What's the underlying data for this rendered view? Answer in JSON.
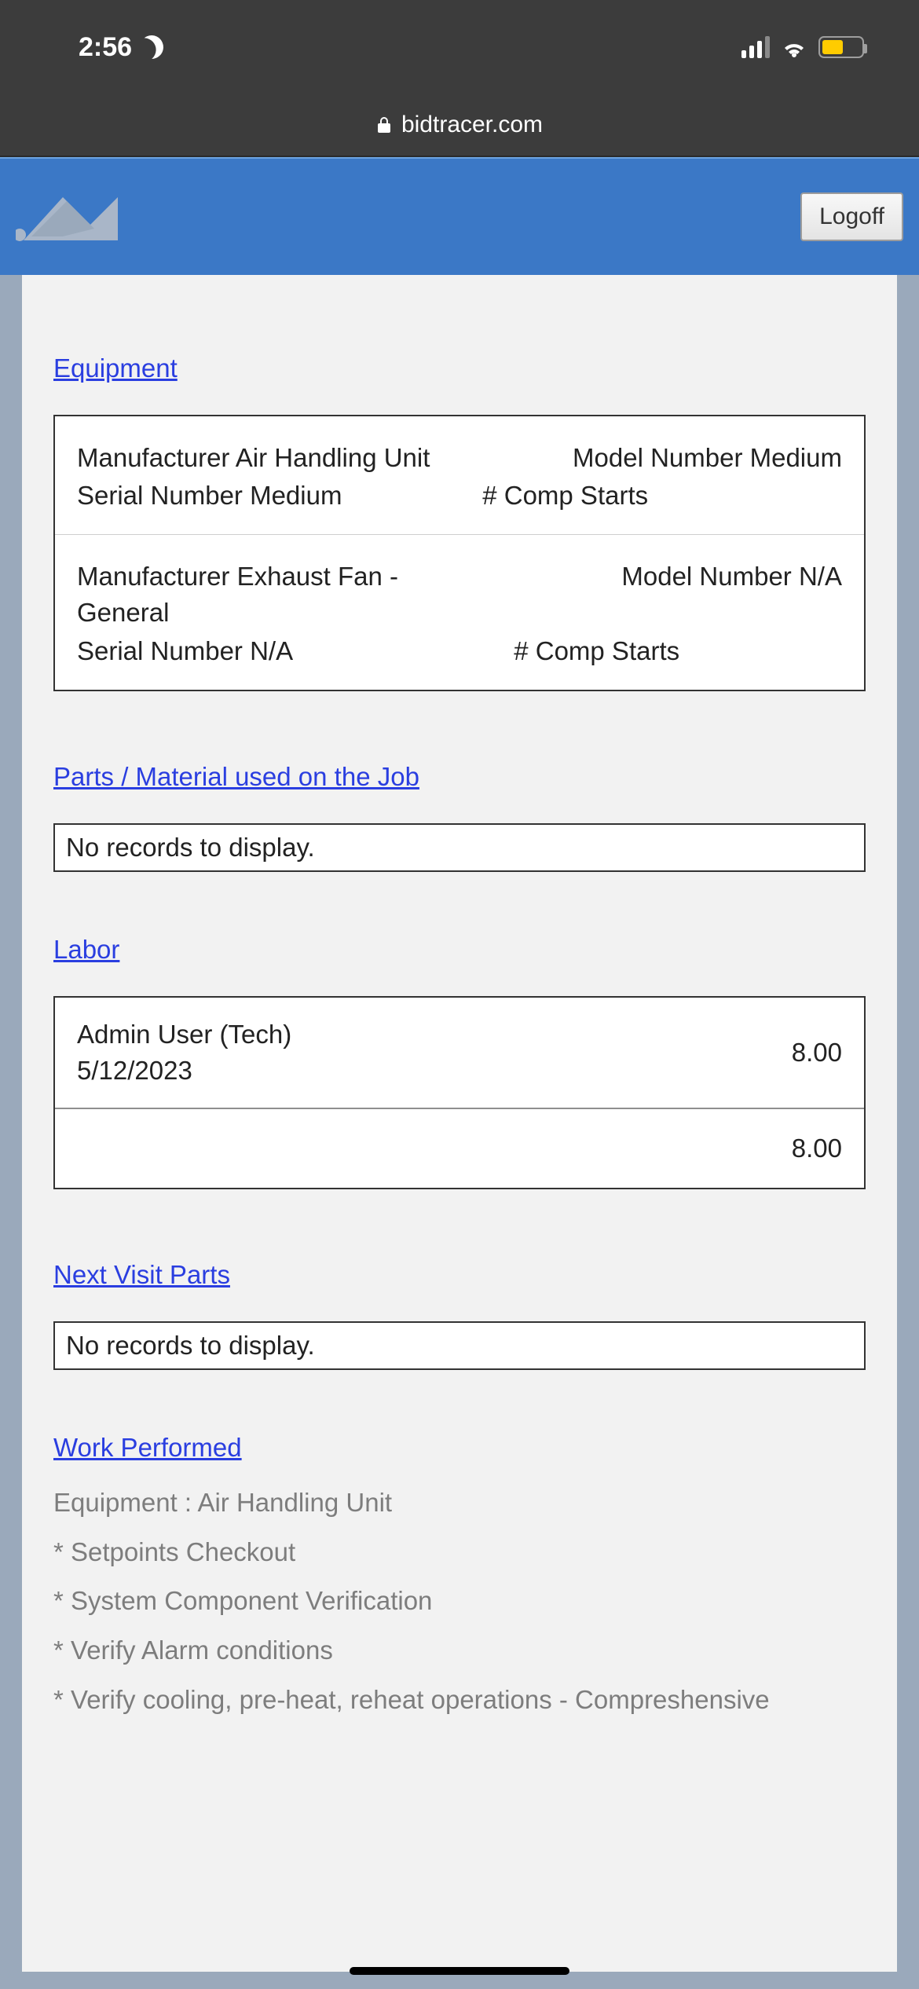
{
  "status": {
    "time": "2:56"
  },
  "browser": {
    "domain": "bidtracer.com"
  },
  "header": {
    "logoff_label": "Logoff"
  },
  "sections": {
    "equipment_label": "Equipment",
    "parts_label": "Parts / Material used on the Job",
    "labor_label": "Labor",
    "next_visit_label": "Next Visit Parts",
    "work_performed_label": "Work Performed"
  },
  "equipment": {
    "labels": {
      "manufacturer_prefix": "Manufacturer ",
      "model_prefix": "Model Number ",
      "serial_prefix": "Serial Number ",
      "comp_starts_prefix": "# Comp Starts "
    },
    "items": [
      {
        "manufacturer": "Air Handling Unit",
        "model": "Medium",
        "serial": "Medium",
        "comp_starts": ""
      },
      {
        "manufacturer": "Exhaust Fan - General",
        "model": "N/A",
        "serial": "N/A",
        "comp_starts": ""
      }
    ]
  },
  "parts": {
    "empty_text": "No records to display."
  },
  "labor": {
    "rows": [
      {
        "name": "Admin User (Tech)",
        "date": "5/12/2023",
        "hours": "8.00"
      }
    ],
    "total_hours": "8.00"
  },
  "next_visit": {
    "empty_text": "No records to display."
  },
  "work_performed": {
    "equipment_line": "Equipment : Air Handling Unit",
    "tasks": [
      "* Setpoints Checkout",
      "* System Component Verification",
      "* Verify Alarm conditions",
      "* Verify cooling, pre-heat, reheat operations - Compreshensive"
    ]
  }
}
